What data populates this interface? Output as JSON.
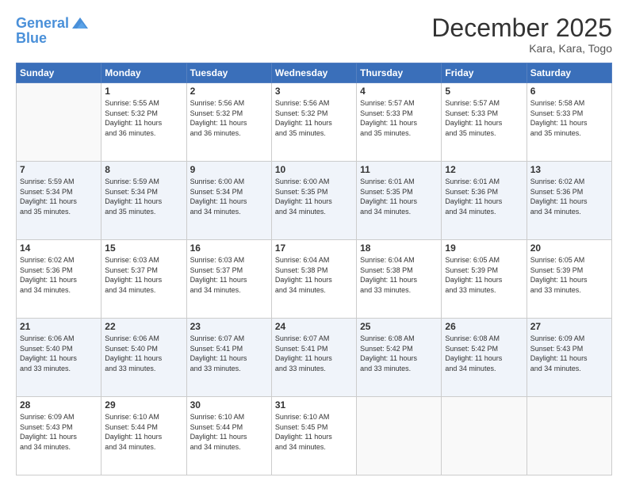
{
  "header": {
    "logo_line1": "General",
    "logo_line2": "Blue",
    "month": "December 2025",
    "location": "Kara, Kara, Togo"
  },
  "weekdays": [
    "Sunday",
    "Monday",
    "Tuesday",
    "Wednesday",
    "Thursday",
    "Friday",
    "Saturday"
  ],
  "weeks": [
    [
      {
        "day": "",
        "info": ""
      },
      {
        "day": "1",
        "info": "Sunrise: 5:55 AM\nSunset: 5:32 PM\nDaylight: 11 hours\nand 36 minutes."
      },
      {
        "day": "2",
        "info": "Sunrise: 5:56 AM\nSunset: 5:32 PM\nDaylight: 11 hours\nand 36 minutes."
      },
      {
        "day": "3",
        "info": "Sunrise: 5:56 AM\nSunset: 5:32 PM\nDaylight: 11 hours\nand 35 minutes."
      },
      {
        "day": "4",
        "info": "Sunrise: 5:57 AM\nSunset: 5:33 PM\nDaylight: 11 hours\nand 35 minutes."
      },
      {
        "day": "5",
        "info": "Sunrise: 5:57 AM\nSunset: 5:33 PM\nDaylight: 11 hours\nand 35 minutes."
      },
      {
        "day": "6",
        "info": "Sunrise: 5:58 AM\nSunset: 5:33 PM\nDaylight: 11 hours\nand 35 minutes."
      }
    ],
    [
      {
        "day": "7",
        "info": "Sunrise: 5:59 AM\nSunset: 5:34 PM\nDaylight: 11 hours\nand 35 minutes."
      },
      {
        "day": "8",
        "info": "Sunrise: 5:59 AM\nSunset: 5:34 PM\nDaylight: 11 hours\nand 35 minutes."
      },
      {
        "day": "9",
        "info": "Sunrise: 6:00 AM\nSunset: 5:34 PM\nDaylight: 11 hours\nand 34 minutes."
      },
      {
        "day": "10",
        "info": "Sunrise: 6:00 AM\nSunset: 5:35 PM\nDaylight: 11 hours\nand 34 minutes."
      },
      {
        "day": "11",
        "info": "Sunrise: 6:01 AM\nSunset: 5:35 PM\nDaylight: 11 hours\nand 34 minutes."
      },
      {
        "day": "12",
        "info": "Sunrise: 6:01 AM\nSunset: 5:36 PM\nDaylight: 11 hours\nand 34 minutes."
      },
      {
        "day": "13",
        "info": "Sunrise: 6:02 AM\nSunset: 5:36 PM\nDaylight: 11 hours\nand 34 minutes."
      }
    ],
    [
      {
        "day": "14",
        "info": "Sunrise: 6:02 AM\nSunset: 5:36 PM\nDaylight: 11 hours\nand 34 minutes."
      },
      {
        "day": "15",
        "info": "Sunrise: 6:03 AM\nSunset: 5:37 PM\nDaylight: 11 hours\nand 34 minutes."
      },
      {
        "day": "16",
        "info": "Sunrise: 6:03 AM\nSunset: 5:37 PM\nDaylight: 11 hours\nand 34 minutes."
      },
      {
        "day": "17",
        "info": "Sunrise: 6:04 AM\nSunset: 5:38 PM\nDaylight: 11 hours\nand 34 minutes."
      },
      {
        "day": "18",
        "info": "Sunrise: 6:04 AM\nSunset: 5:38 PM\nDaylight: 11 hours\nand 33 minutes."
      },
      {
        "day": "19",
        "info": "Sunrise: 6:05 AM\nSunset: 5:39 PM\nDaylight: 11 hours\nand 33 minutes."
      },
      {
        "day": "20",
        "info": "Sunrise: 6:05 AM\nSunset: 5:39 PM\nDaylight: 11 hours\nand 33 minutes."
      }
    ],
    [
      {
        "day": "21",
        "info": "Sunrise: 6:06 AM\nSunset: 5:40 PM\nDaylight: 11 hours\nand 33 minutes."
      },
      {
        "day": "22",
        "info": "Sunrise: 6:06 AM\nSunset: 5:40 PM\nDaylight: 11 hours\nand 33 minutes."
      },
      {
        "day": "23",
        "info": "Sunrise: 6:07 AM\nSunset: 5:41 PM\nDaylight: 11 hours\nand 33 minutes."
      },
      {
        "day": "24",
        "info": "Sunrise: 6:07 AM\nSunset: 5:41 PM\nDaylight: 11 hours\nand 33 minutes."
      },
      {
        "day": "25",
        "info": "Sunrise: 6:08 AM\nSunset: 5:42 PM\nDaylight: 11 hours\nand 33 minutes."
      },
      {
        "day": "26",
        "info": "Sunrise: 6:08 AM\nSunset: 5:42 PM\nDaylight: 11 hours\nand 34 minutes."
      },
      {
        "day": "27",
        "info": "Sunrise: 6:09 AM\nSunset: 5:43 PM\nDaylight: 11 hours\nand 34 minutes."
      }
    ],
    [
      {
        "day": "28",
        "info": "Sunrise: 6:09 AM\nSunset: 5:43 PM\nDaylight: 11 hours\nand 34 minutes."
      },
      {
        "day": "29",
        "info": "Sunrise: 6:10 AM\nSunset: 5:44 PM\nDaylight: 11 hours\nand 34 minutes."
      },
      {
        "day": "30",
        "info": "Sunrise: 6:10 AM\nSunset: 5:44 PM\nDaylight: 11 hours\nand 34 minutes."
      },
      {
        "day": "31",
        "info": "Sunrise: 6:10 AM\nSunset: 5:45 PM\nDaylight: 11 hours\nand 34 minutes."
      },
      {
        "day": "",
        "info": ""
      },
      {
        "day": "",
        "info": ""
      },
      {
        "day": "",
        "info": ""
      }
    ]
  ]
}
